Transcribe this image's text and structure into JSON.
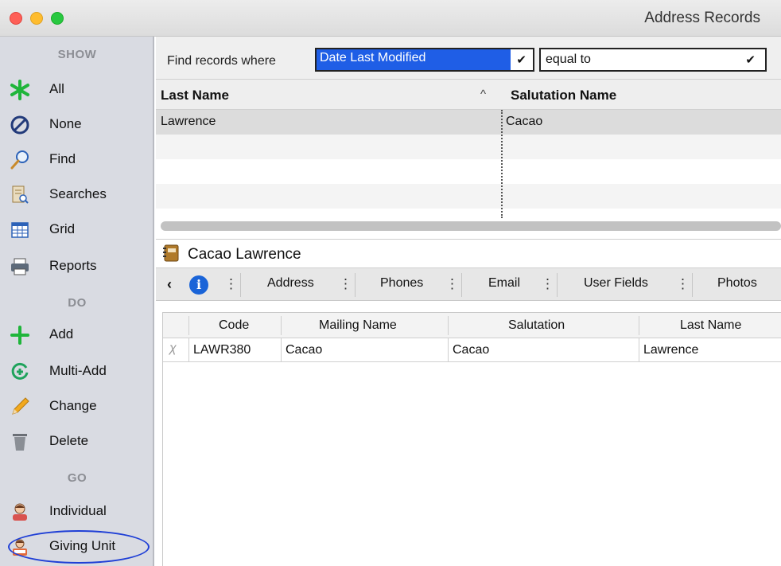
{
  "window": {
    "title": "Address Records"
  },
  "sidebar": {
    "sections": {
      "show": "SHOW",
      "do": "DO",
      "go": "GO"
    },
    "show_items": [
      {
        "label": "All",
        "icon": "asterisk-icon"
      },
      {
        "label": "None",
        "icon": "no-entry-icon"
      },
      {
        "label": "Find",
        "icon": "magnifier-icon"
      },
      {
        "label": "Searches",
        "icon": "saved-searches-icon"
      },
      {
        "label": "Grid",
        "icon": "grid-icon"
      },
      {
        "label": "Reports",
        "icon": "printer-icon"
      }
    ],
    "do_items": [
      {
        "label": "Add",
        "icon": "plus-icon"
      },
      {
        "label": "Multi-Add",
        "icon": "multi-add-icon"
      },
      {
        "label": "Change",
        "icon": "pencil-icon"
      },
      {
        "label": "Delete",
        "icon": "trash-icon"
      }
    ],
    "go_items": [
      {
        "label": "Individual",
        "icon": "individual-icon"
      },
      {
        "label": "Giving Unit",
        "icon": "giving-unit-icon"
      }
    ],
    "highlight_color": "#1f3fd6"
  },
  "find": {
    "label": "Find records where",
    "field_value": "Date Last Modified",
    "operator_value": "equal to",
    "accent": "#1f5ee6"
  },
  "results": {
    "columns": {
      "last_name": "Last Name",
      "salutation_name": "Salutation Name"
    },
    "sort_indicator": "^",
    "rows": [
      {
        "last_name": "Lawrence",
        "salutation_name": "Cacao"
      }
    ]
  },
  "record": {
    "title": "Cacao Lawrence",
    "tabs": [
      "Address",
      "Phones",
      "Email",
      "User Fields",
      "Photos"
    ],
    "prev_label": "‹",
    "info_label": "i",
    "grid": {
      "columns": [
        "Code",
        "Mailing Name",
        "Salutation",
        "Last Name"
      ],
      "rows": [
        {
          "code": "LAWR380",
          "mailing_name": "Cacao",
          "salutation": "Cacao",
          "last_name": "Lawrence"
        }
      ]
    }
  }
}
